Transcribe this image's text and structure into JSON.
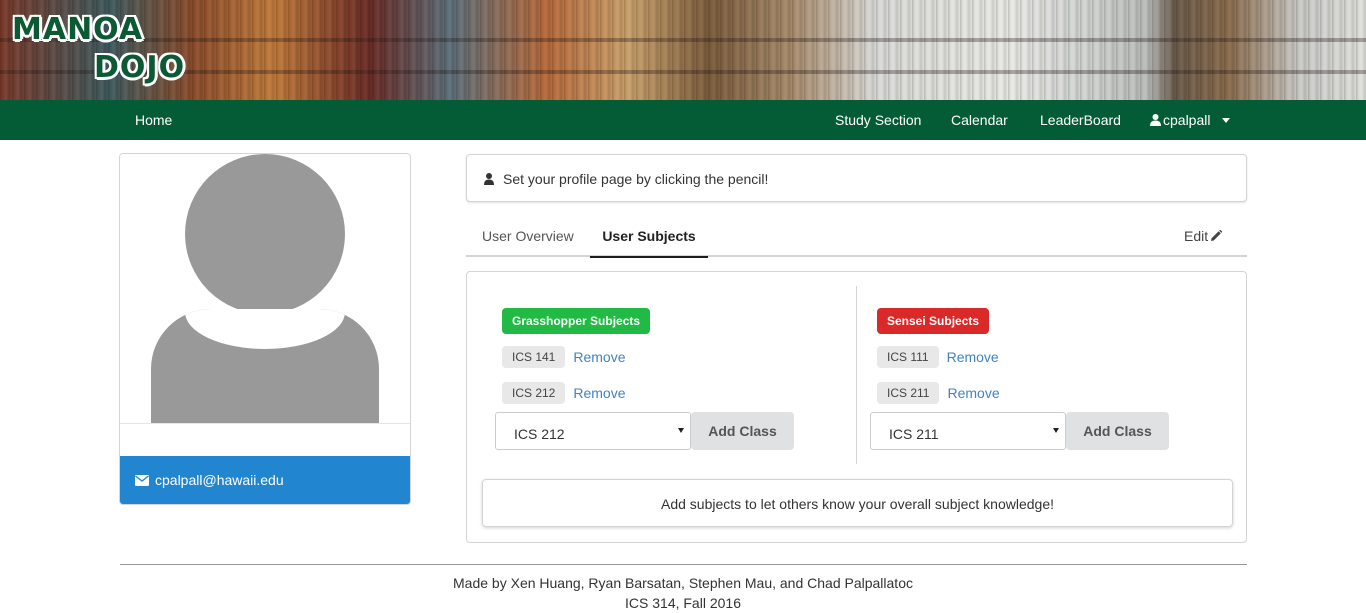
{
  "banner": {
    "logo_line1": "MANOA",
    "logo_line2": "DOJO",
    "logo_icon": "manoa-dojo-logo"
  },
  "navbar": {
    "home": "Home",
    "study_section": "Study Section",
    "calendar": "Calendar",
    "leaderboard": "LeaderBoard",
    "username": "cpalpall",
    "user_icon": "user-icon",
    "caret_icon": "caret-down-icon",
    "bg_color": "#045c36"
  },
  "profile": {
    "avatar_icon": "default-avatar",
    "email": "cpalpall@hawaii.edu",
    "email_icon": "envelope-icon",
    "email_bar_color": "#2185d0"
  },
  "info": {
    "text": "Set your profile page by clicking the pencil!",
    "icon": "user-icon"
  },
  "tabs": {
    "overview": "User Overview",
    "subjects": "User Subjects",
    "active": "User Subjects",
    "edit": "Edit",
    "edit_icon": "pencil-icon"
  },
  "grasshopper": {
    "title": "Grasshopper Subjects",
    "color": "#21ba45",
    "subjects": [
      {
        "code": "ICS 141",
        "action": "Remove"
      },
      {
        "code": "ICS 212",
        "action": "Remove"
      }
    ],
    "select_value": "ICS 212",
    "add_label": "Add Class"
  },
  "sensei": {
    "title": "Sensei Subjects",
    "color": "#db2828",
    "subjects": [
      {
        "code": "ICS 111",
        "action": "Remove"
      },
      {
        "code": "ICS 211",
        "action": "Remove"
      }
    ],
    "select_value": "ICS 211",
    "add_label": "Add Class"
  },
  "hint": "Add subjects to let others know your overall subject knowledge!",
  "footer": {
    "line1": "Made by Xen Huang, Ryan Barsatan, Stephen Mau, and Chad Palpallatoc",
    "line2": "ICS 314, Fall 2016"
  }
}
